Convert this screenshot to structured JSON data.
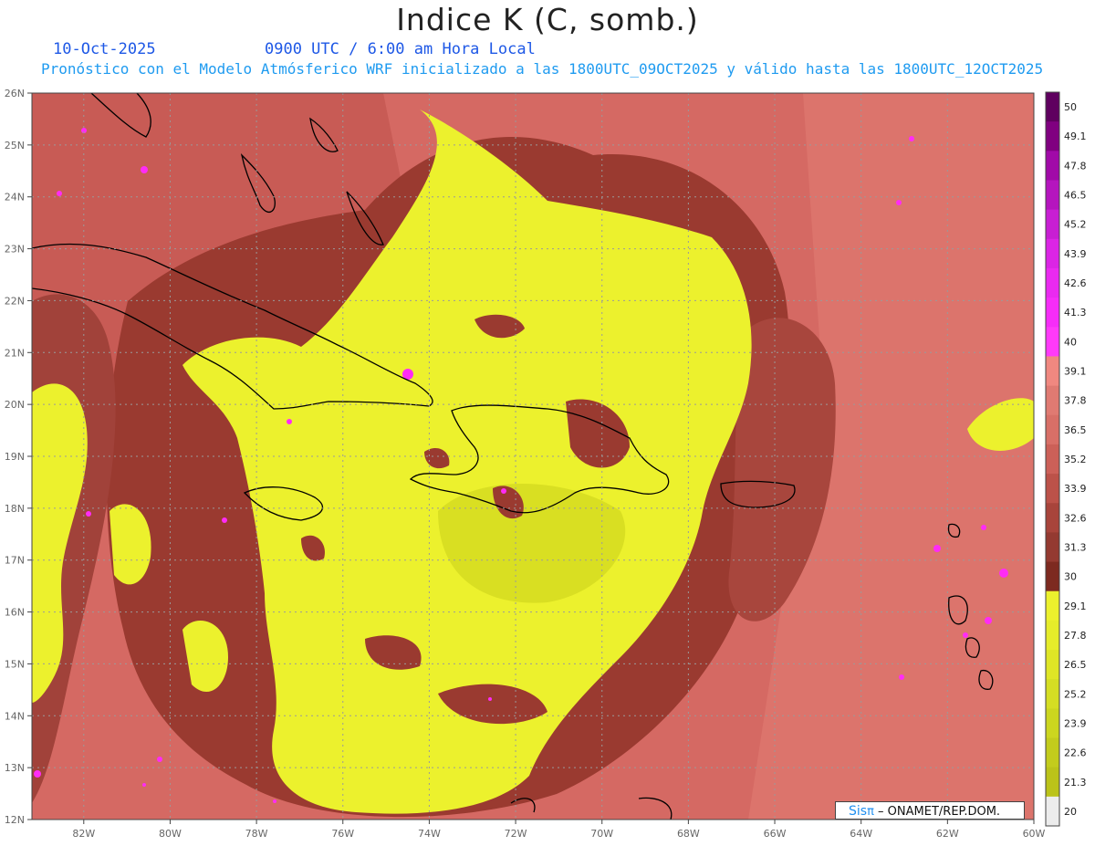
{
  "header": {
    "title": "Indice K (C, somb.)",
    "date": "10-Oct-2025",
    "time": "0900 UTC / 6:00 am Hora Local",
    "forecast_note": "Pronóstico con el Modelo Atmósferico WRF inicializado a las 1800UTC_09OCT2025 y válido hasta las  1800UTC_12OCT2025"
  },
  "map": {
    "lat_labels": [
      "26N",
      "25N",
      "24N",
      "23N",
      "22N",
      "21N",
      "20N",
      "19N",
      "18N",
      "17N",
      "16N",
      "15N",
      "14N",
      "13N",
      "12N"
    ],
    "lon_labels": [
      "82W",
      "80W",
      "78W",
      "76W",
      "74W",
      "72W",
      "70W",
      "68W",
      "66W",
      "64W",
      "62W",
      "60W"
    ],
    "lat_range": [
      12,
      26
    ],
    "lon_range": [
      -83.2,
      -60
    ],
    "grid": true,
    "colors": {
      "low_k": "#ecf12d",
      "mid_k": "#9a3a30",
      "high_k": "#d86a64",
      "extreme_k": "#ff2bf6",
      "coast": "#000000"
    }
  },
  "legend": {
    "levels": [
      "50",
      "49.1",
      "47.8",
      "46.5",
      "45.2",
      "43.9",
      "42.6",
      "41.3",
      "40",
      "39.1",
      "37.8",
      "36.5",
      "35.2",
      "33.9",
      "32.6",
      "31.3",
      "30",
      "29.1",
      "27.8",
      "26.5",
      "25.2",
      "23.9",
      "22.6",
      "21.3",
      "20"
    ],
    "colors": [
      "#5f005f",
      "#800080",
      "#a10aa8",
      "#b515be",
      "#c81fd3",
      "#db25e5",
      "#ea2af0",
      "#f62df8",
      "#ff3af9",
      "#f08880",
      "#e07a72",
      "#d86f67",
      "#cc6058",
      "#bc5249",
      "#a8443b",
      "#943a31",
      "#7d2a20",
      "#ecf12d",
      "#e6ec2a",
      "#dfe626",
      "#d5de23",
      "#ccd61f",
      "#c3cc1c",
      "#bbc319",
      "#ececec"
    ]
  },
  "credit": {
    "brand": "Sis",
    "pi": "π",
    "agency": "– ONAMET/REP.DOM."
  }
}
